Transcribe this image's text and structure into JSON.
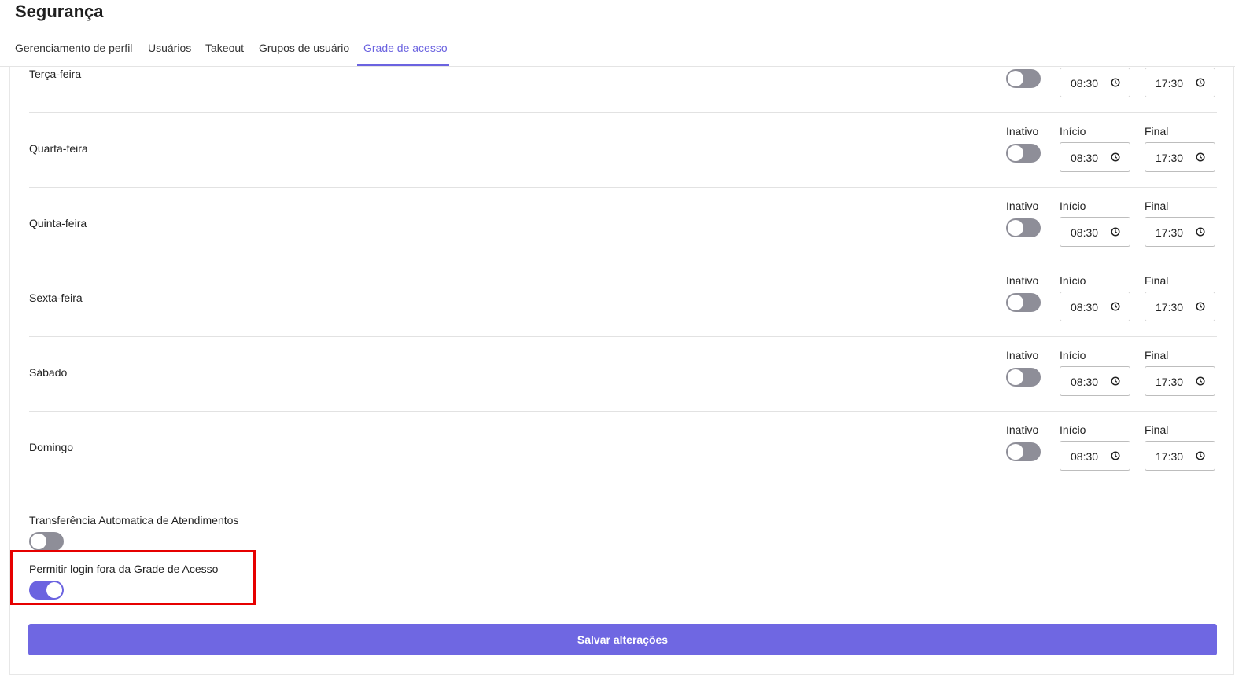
{
  "page": {
    "title": "Segurança"
  },
  "tabs": [
    {
      "label": "Gerenciamento de perfil"
    },
    {
      "label": "Usuários"
    },
    {
      "label": "Takeout"
    },
    {
      "label": "Grupos de usuário"
    },
    {
      "label": "Grade de acesso"
    }
  ],
  "active_tab": "Grade de acesso",
  "schedule": {
    "labels": {
      "status": "Inativo",
      "start": "Início",
      "end": "Final"
    },
    "days": [
      {
        "name": "Terça-feira",
        "active": false,
        "start": "08:30",
        "end": "17:30"
      },
      {
        "name": "Quarta-feira",
        "active": false,
        "start": "08:30",
        "end": "17:30"
      },
      {
        "name": "Quinta-feira",
        "active": false,
        "start": "08:30",
        "end": "17:30"
      },
      {
        "name": "Sexta-feira",
        "active": false,
        "start": "08:30",
        "end": "17:30"
      },
      {
        "name": "Sábado",
        "active": false,
        "start": "08:30",
        "end": "17:30"
      },
      {
        "name": "Domingo",
        "active": false,
        "start": "08:30",
        "end": "17:30"
      }
    ]
  },
  "settings": {
    "auto_transfer": {
      "label": "Transferência Automatica de Atendimentos",
      "enabled": false
    },
    "login_outside": {
      "label": "Permitir login fora da Grade de Acesso",
      "enabled": true
    }
  },
  "actions": {
    "save_label": "Salvar alterações"
  },
  "colors": {
    "accent": "#6b63e0",
    "toggle_off": "#8e8e98",
    "highlight": "#e60000"
  },
  "icons": {
    "time": "clock-icon"
  }
}
